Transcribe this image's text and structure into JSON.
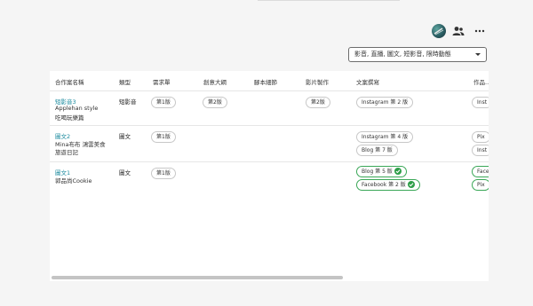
{
  "header": {
    "filter_text": "影音, 直播, 圖文, 短影音, 限時動態"
  },
  "table": {
    "columns": {
      "partner": "合作案名稱",
      "type": "類型",
      "needs": "需求單",
      "outline": "創意大綱",
      "script": "腳本細節",
      "video": "影片製作",
      "copy": "文案撰寫",
      "works": "作品..."
    },
    "rows": [
      {
        "title": "短影音3",
        "line1": "Applehan style",
        "line2": "吃喝玩樂篇",
        "type": "短影音",
        "needs": "第1版",
        "outline": "第2版",
        "video": "第2版",
        "copy": [
          {
            "label": "Instagram  第 2 版",
            "done": false
          }
        ],
        "works": [
          "Inst"
        ]
      },
      {
        "title": "圖文2",
        "line1": "Mina布布 鴻雲美食",
        "line2": "旅遊日記",
        "type": "圖文",
        "needs": "第1版",
        "copy": [
          {
            "label": "Instagram  第 4 版",
            "done": false
          },
          {
            "label": "Blog  第 7 版",
            "done": false
          }
        ],
        "works": [
          "Pix",
          "Inst"
        ]
      },
      {
        "title": "圖文1",
        "line1": "郭品尚Cookie",
        "type": "圖文",
        "needs": "第1版",
        "copy": [
          {
            "label": "Blog  第 5 版",
            "done": true
          },
          {
            "label": "Facebook  第 2 版",
            "done": true
          }
        ],
        "works": [
          "Face",
          "Pix"
        ]
      }
    ]
  }
}
